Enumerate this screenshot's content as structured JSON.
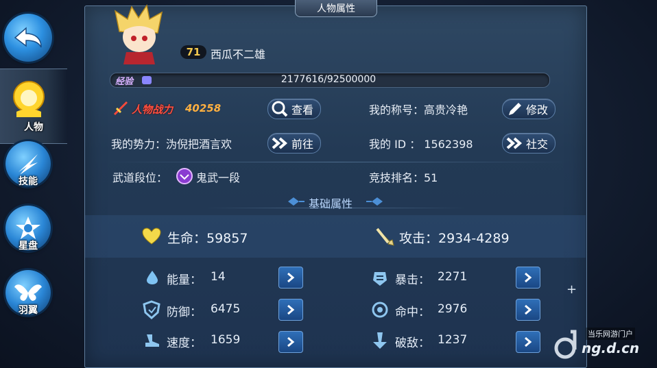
{
  "window_title": "人物属性",
  "nav": {
    "back": "back",
    "items": [
      {
        "label": "人物",
        "icon": "character-icon"
      },
      {
        "label": "技能",
        "icon": "skill-icon"
      },
      {
        "label": "星盘",
        "icon": "star-chart-icon"
      },
      {
        "label": "羽翼",
        "icon": "wings-icon"
      }
    ]
  },
  "profile": {
    "level": "71",
    "name": "西瓜不二雄",
    "xp_label": "经验",
    "xp_text": "2177616/92500000",
    "xp_fraction": 0.0235,
    "power_label": "人物战力",
    "power_value": "40258",
    "view_button": "查看",
    "title_label": "我的称号：高贵冷艳",
    "edit_button": "修改",
    "faction_label": "我的势力：沩倪把酒言欢",
    "goto_button": "前往",
    "id_label": "我的 ID  ：  1562398",
    "social_button": "社交",
    "rank_label": "武道段位：",
    "rank_value": "鬼武一段",
    "arena_label": "竞技排名：51"
  },
  "basic": {
    "title": "基础属性",
    "hp": "生命：59857",
    "attack": "攻击：2934-4289",
    "stats": [
      {
        "label": "能量：",
        "value": "14",
        "icon": "energy-icon"
      },
      {
        "label": "暴击：",
        "value": "2271",
        "icon": "crit-icon"
      },
      {
        "label": "防御：",
        "value": "6475",
        "icon": "defense-icon"
      },
      {
        "label": "命中：",
        "value": "2976",
        "icon": "accuracy-icon"
      },
      {
        "label": "速度：",
        "value": "1659",
        "icon": "speed-icon"
      },
      {
        "label": "破敌：",
        "value": "1237",
        "icon": "break-icon"
      }
    ]
  },
  "watermark": {
    "line1": "当乐网游门户",
    "line2": "ng.d.cn"
  },
  "colors": {
    "accent": "#2f6fb8",
    "power": "#ff5040",
    "xp": "#8a86ff"
  }
}
